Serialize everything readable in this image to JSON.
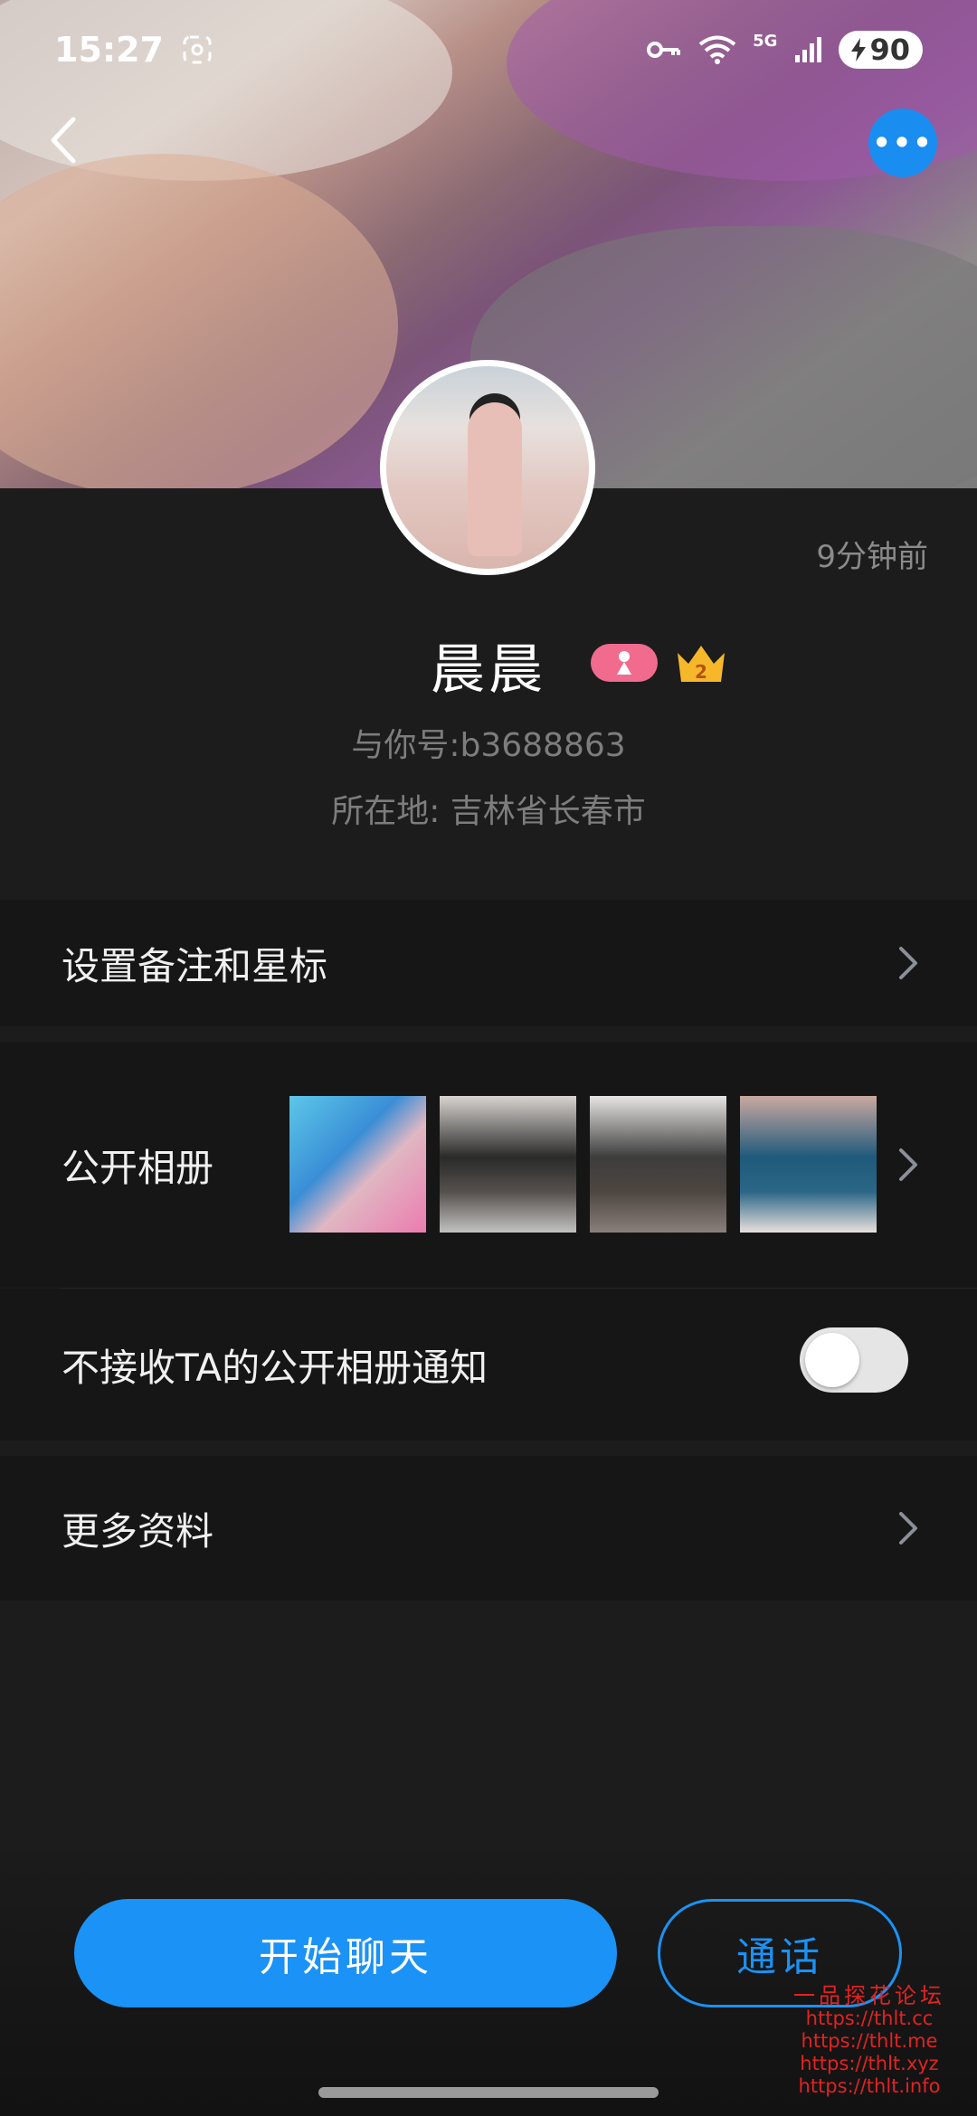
{
  "status_bar": {
    "time": "15:27",
    "network": "5G",
    "battery": "90",
    "icons": [
      "screenshot-icon",
      "key-icon",
      "wifi-icon",
      "signal-icon",
      "battery-icon"
    ]
  },
  "header": {
    "back_icon": "chevron-left-icon",
    "more_icon": "more-dots-icon",
    "more_label": "•••",
    "accent_color": "#1a8df1"
  },
  "profile": {
    "last_active": "9分钟前",
    "name": "晨晨",
    "gender_badge": "female-icon",
    "level": "2",
    "id_line": "与你号:b3688863",
    "location_line": "所在地: 吉林省长春市"
  },
  "rows": {
    "remark_label": "设置备注和星标",
    "album_label": "公开相册",
    "notify_label": "不接收TA的公开相册通知",
    "notify_enabled": false,
    "more_label": "更多资料"
  },
  "actions": {
    "chat_label": "开始聊天",
    "call_label": "通话"
  },
  "watermark": {
    "title": "一品探花论坛",
    "lines": [
      "https://thlt.cc",
      "https://thlt.me",
      "https://thlt.xyz",
      "https://thlt.info"
    ]
  }
}
